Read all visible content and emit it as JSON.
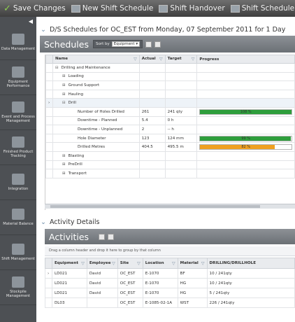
{
  "toolbar": {
    "save_label": "Save Changes",
    "new_schedule_label": "New Shift Schedule",
    "handover_label": "Shift Handover",
    "template_label": "Shift Schedule Tem"
  },
  "sidebar": {
    "collapse": "◀",
    "items": [
      {
        "label": "Data Management",
        "icon": "data-icon"
      },
      {
        "label": "Equipment Performance",
        "icon": "equipment-icon"
      },
      {
        "label": "Event and Process Management",
        "icon": "event-icon"
      },
      {
        "label": "Finished Product Tracking",
        "icon": "product-icon"
      },
      {
        "label": "Integration",
        "icon": "integration-icon"
      },
      {
        "label": "Material Balance",
        "icon": "material-icon"
      },
      {
        "label": "Shift Management",
        "icon": "shift-icon"
      },
      {
        "label": "Stockpile Management",
        "icon": "stockpile-icon"
      }
    ]
  },
  "schedule_panel": {
    "title": "D/S Schedules for OC_EST from Monday, 07 September 2011 for 1 Day",
    "header_label": "Schedules",
    "sort_by_label": "Sort by",
    "sort_by_value": "Equipment ▾"
  },
  "schedule_grid": {
    "columns": [
      "Name",
      "Actual",
      "Target",
      "Progress"
    ],
    "rows": [
      {
        "name": "Drilling and Maintenance",
        "expander": "⊟",
        "indent": 0,
        "actual": "",
        "target": "",
        "progress": null
      },
      {
        "name": "Loading",
        "expander": "⊞",
        "indent": 1,
        "actual": "",
        "target": "",
        "progress": null
      },
      {
        "name": "Ground Support",
        "expander": "⊞",
        "indent": 1,
        "actual": "",
        "target": "",
        "progress": null
      },
      {
        "name": "Hauling",
        "expander": "⊞",
        "indent": 1,
        "actual": "",
        "target": "",
        "progress": null
      },
      {
        "name": "Drill",
        "expander": "⊟",
        "indent": 1,
        "actual": "",
        "target": "",
        "progress": null,
        "selected": true
      },
      {
        "name": "Number of Holes Drilled",
        "expander": "",
        "indent": 2,
        "actual": "261",
        "target": "241 qty",
        "progress": {
          "value": 1.08,
          "label": "108 %",
          "color": "#2e9e3c"
        }
      },
      {
        "name": "Downtime - Planned",
        "expander": "",
        "indent": 2,
        "actual": "5.4",
        "target": "0 h",
        "progress": null
      },
      {
        "name": "Downtime - Unplanned",
        "expander": "",
        "indent": 2,
        "actual": "2",
        "target": "-- h",
        "progress": null
      },
      {
        "name": "Hole Diameter",
        "expander": "",
        "indent": 2,
        "actual": "123",
        "target": "124 mm",
        "progress": {
          "value": 0.99,
          "label": "99 %",
          "color": "#2e9e3c"
        }
      },
      {
        "name": "Drilled Metres",
        "expander": "",
        "indent": 2,
        "actual": "404.5",
        "target": "495.5 m",
        "progress": {
          "value": 0.82,
          "label": "82 %",
          "color": "#f0a020"
        }
      },
      {
        "name": "Blasting",
        "expander": "⊞",
        "indent": 1,
        "actual": "",
        "target": "",
        "progress": null
      },
      {
        "name": "PreDrill",
        "expander": "⊞",
        "indent": 1,
        "actual": "",
        "target": "",
        "progress": null
      },
      {
        "name": "Transport",
        "expander": "⊞",
        "indent": 1,
        "actual": "",
        "target": "",
        "progress": null
      }
    ]
  },
  "activity_panel": {
    "title": "Activity Details",
    "header_label": "Activities",
    "group_hint": "Drag a column header and drop it here to group by that column"
  },
  "activity_grid": {
    "columns": [
      "Equipment",
      "Employee",
      "Site",
      "Location",
      "Material",
      "DRILLING/DRILLHOLE"
    ],
    "rows": [
      [
        "LD021",
        "David",
        "OC_EST",
        "E-1070",
        "BF",
        "10 / 241qty"
      ],
      [
        "LD021",
        "David",
        "OC_EST",
        "E-1070",
        "HG",
        "10 / 241qty"
      ],
      [
        "LD021",
        "David",
        "OC_EST",
        "E-1070",
        "HG",
        "5 / 241qty"
      ],
      [
        "DL03",
        "",
        "OC_EST",
        "E-1085-02-1A",
        "WST",
        "226 / 241qty"
      ]
    ]
  }
}
